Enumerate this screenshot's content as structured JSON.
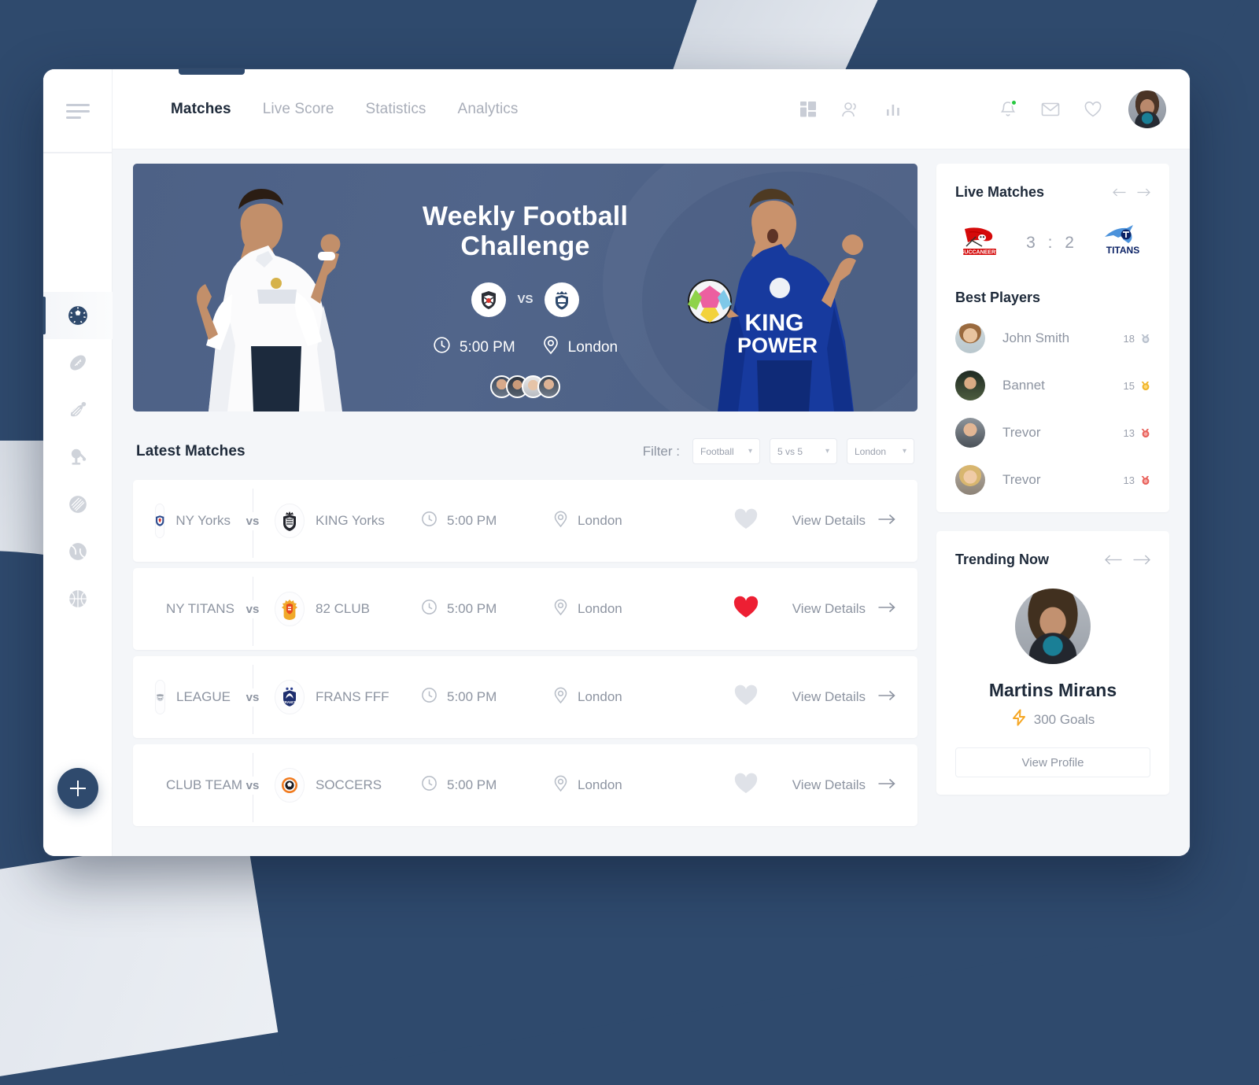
{
  "app": {
    "accent": "#2f4a6d",
    "bg": "#2f4a6d",
    "surface": "#f4f6f9"
  },
  "nav": {
    "tabs": [
      {
        "label": "Matches",
        "active": true
      },
      {
        "label": "Live Score",
        "active": false
      },
      {
        "label": "Statistics",
        "active": false
      },
      {
        "label": "Analytics",
        "active": false
      }
    ],
    "tools": [
      {
        "name": "dashboard-grid-icon"
      },
      {
        "name": "users-icon"
      },
      {
        "name": "bar-chart-icon"
      },
      {
        "name": "notification-bell-icon",
        "badge": true,
        "badge_color": "#27c840"
      },
      {
        "name": "mail-icon"
      },
      {
        "name": "heart-icon"
      }
    ],
    "menu_icon": "hamburger-icon",
    "avatar": "user-avatar"
  },
  "rail": {
    "items": [
      {
        "name": "soccer-ball-icon",
        "label": "Football",
        "active": true
      },
      {
        "name": "american-football-icon",
        "label": "American Football",
        "active": false
      },
      {
        "name": "badminton-shuttlecock-icon",
        "label": "Badminton",
        "active": false
      },
      {
        "name": "table-tennis-icon",
        "label": "Table Tennis",
        "active": false
      },
      {
        "name": "cricket-ball-icon",
        "label": "Cricket",
        "active": false
      },
      {
        "name": "tennis-ball-icon",
        "label": "Tennis",
        "active": false
      },
      {
        "name": "basketball-icon",
        "label": "Basketball",
        "active": false
      }
    ],
    "add_label": "+"
  },
  "hero": {
    "title_line1": "Weekly Football",
    "title_line2": "Challenge",
    "vs": "VS",
    "time": "5:00 PM",
    "location": "London",
    "home_crest": "home-team-crest",
    "away_crest": "away-team-crest",
    "attendee_count": 4
  },
  "matches_section": {
    "title": "Latest Matches",
    "filter_label": "Filter :",
    "filters": [
      {
        "name": "sport-filter",
        "value": "Football",
        "options": [
          "Football"
        ]
      },
      {
        "name": "format-filter",
        "value": "5 vs 5",
        "options": [
          "5 vs 5"
        ]
      },
      {
        "name": "city-filter",
        "value": "London",
        "options": [
          "London"
        ]
      }
    ],
    "vs": "vs",
    "view_details": "View Details",
    "rows": [
      {
        "team_a": "NY Yorks",
        "team_b": "KING Yorks",
        "time": "5:00 PM",
        "location": "London",
        "favorited": false
      },
      {
        "team_a": "NY TITANS",
        "team_b": "82 CLUB",
        "time": "5:00 PM",
        "location": "London",
        "favorited": true
      },
      {
        "team_a": "LEAGUE",
        "team_b": "FRANS FFF",
        "time": "5:00 PM",
        "location": "London",
        "favorited": false
      },
      {
        "team_a": "CLUB TEAM",
        "team_b": "SOCCERS",
        "time": "5:00 PM",
        "location": "London",
        "favorited": false
      }
    ]
  },
  "live_matches": {
    "title": "Live Matches",
    "home_team": "Buccaneers",
    "away_team": "Titans",
    "score": "3 : 2",
    "home_score": 3,
    "away_score": 2
  },
  "best_players": {
    "title": "Best Players",
    "rows": [
      {
        "name": "John Smith",
        "score": "18",
        "medal": "silver",
        "medal_color": "#b8c0cc"
      },
      {
        "name": "Bannet",
        "score": "15",
        "medal": "gold",
        "medal_color": "#f0b429"
      },
      {
        "name": "Trevor",
        "score": "13",
        "medal": "bronze",
        "medal_color": "#e8605a"
      },
      {
        "name": "Trevor",
        "score": "13",
        "medal": "bronze",
        "medal_color": "#e8605a"
      }
    ]
  },
  "trending": {
    "title": "Trending Now",
    "player_name": "Martins Mirans",
    "goals": "300 Goals",
    "goals_icon": "lightning-bolt-icon",
    "goals_icon_color": "#f5a623",
    "button_label": "View Profile"
  }
}
